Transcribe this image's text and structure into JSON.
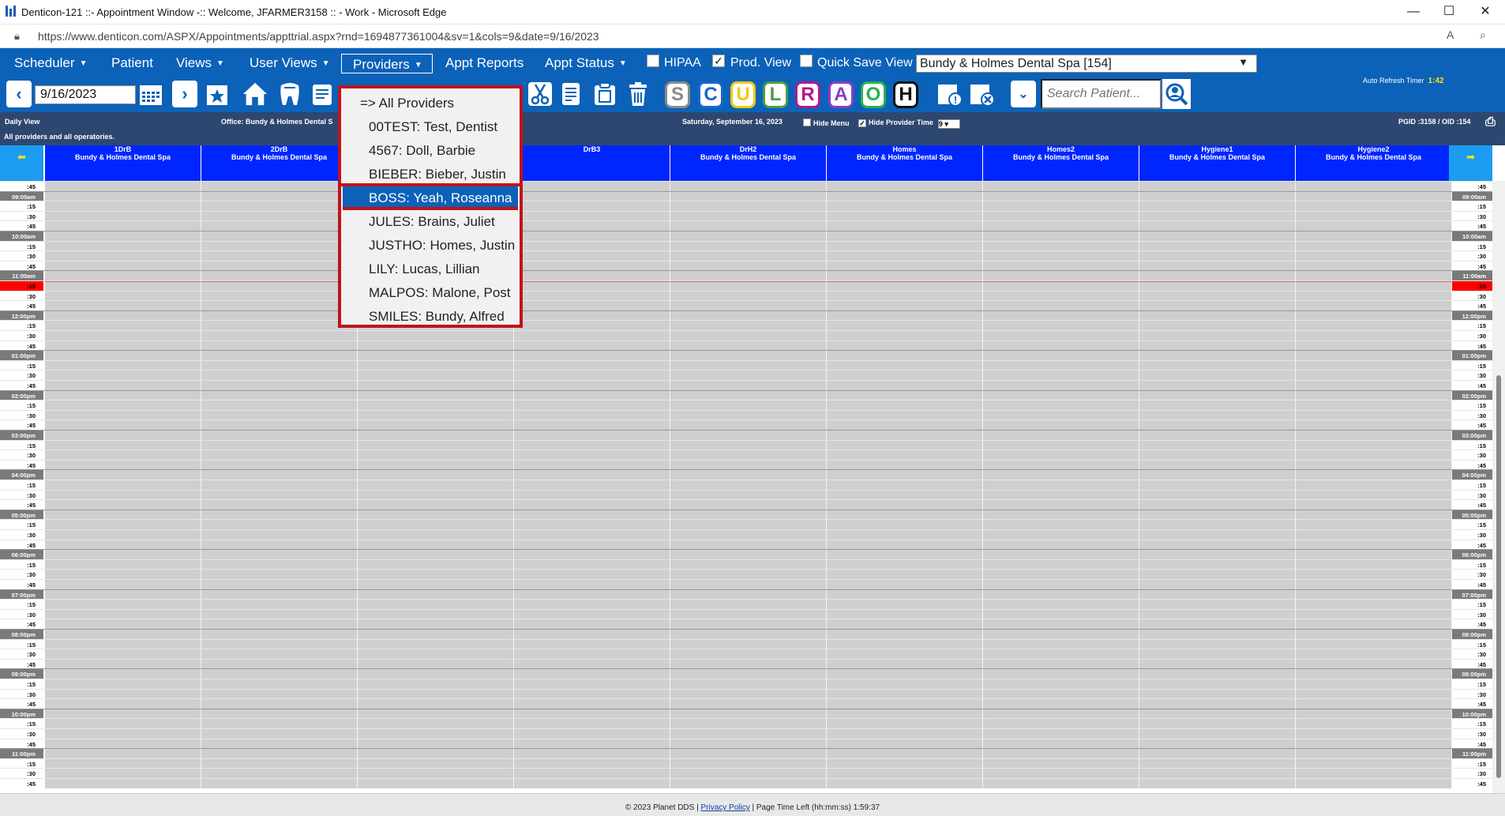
{
  "window": {
    "title": "Denticon-121 ::- Appointment Window -:: Welcome, JFARMER3158 :: - Work - Microsoft Edge"
  },
  "address": {
    "url": "https://www.denticon.com/ASPX/Appointments/appttrial.aspx?rnd=1694877361004&sv=1&cols=9&date=9/16/2023"
  },
  "menu": {
    "scheduler": "Scheduler",
    "patient": "Patient",
    "views": "Views",
    "user_views": "User Views",
    "providers": "Providers",
    "appt_reports": "Appt Reports",
    "appt_status": "Appt Status",
    "hipaa": "HIPAA",
    "prod_view": "Prod. View",
    "quick_save": "Quick Save View",
    "office": "Bundy & Holmes Dental Spa [154]"
  },
  "toolbar": {
    "date": "9/16/2023",
    "search_placeholder": "Search Patient...",
    "auto_refresh_label": "Auto Refresh Timer",
    "auto_refresh_value": "1:42",
    "letters": [
      {
        "t": "S",
        "color": "#8a8a8a"
      },
      {
        "t": "C",
        "color": "#1a66c9"
      },
      {
        "t": "U",
        "color": "#f2c80f"
      },
      {
        "t": "L",
        "color": "#4a9d47"
      },
      {
        "t": "R",
        "color": "#b5178c"
      },
      {
        "t": "A",
        "color": "#8a3cc9"
      },
      {
        "t": "O",
        "color": "#27b34a"
      },
      {
        "t": "H",
        "color": "#111111"
      }
    ]
  },
  "info": {
    "daily_view": "Daily View",
    "office": "Office: Bundy & Holmes Dental S",
    "all_providers": "All providers and all operatories.",
    "date": "Saturday, September 16, 2023",
    "hide_menu": "Hide Menu",
    "hide_provider_time": "Hide Provider Time",
    "cols": "9",
    "pgid": "PGID :3158  /  OID :154"
  },
  "columns": [
    {
      "name": "1DrB",
      "sub": "Bundy & Holmes Dental Spa"
    },
    {
      "name": "2DrB",
      "sub": "Bundy & Holmes Dental Spa"
    },
    {
      "name": "",
      "sub": ""
    },
    {
      "name": "DrB3",
      "sub": ""
    },
    {
      "name": "DrH2",
      "sub": "Bundy & Holmes Dental Spa"
    },
    {
      "name": "Homes",
      "sub": "Bundy & Holmes Dental Spa"
    },
    {
      "name": "Homes2",
      "sub": "Bundy & Holmes Dental Spa"
    },
    {
      "name": "Hygiene1",
      "sub": "Bundy & Holmes Dental Spa"
    },
    {
      "name": "Hygiene2",
      "sub": "Bundy & Holmes Dental Spa"
    }
  ],
  "times": [
    ":45",
    "09:00am",
    ":15",
    ":30",
    ":45",
    "10:00am",
    ":15",
    ":30",
    ":45",
    "11:00am",
    ":15",
    ":30",
    ":45",
    "12:00pm",
    ":15",
    ":30",
    ":45",
    "01:00pm",
    ":15",
    ":30",
    ":45",
    "02:00pm",
    ":15",
    ":30",
    ":45",
    "03:00pm",
    ":15",
    ":30",
    ":45",
    "04:00pm",
    ":15",
    ":30",
    ":45",
    "05:00pm",
    ":15",
    ":30",
    ":45",
    "06:00pm",
    ":15",
    ":30",
    ":45",
    "07:00pm",
    ":15",
    ":30",
    ":45",
    "08:00pm",
    ":15",
    ":30",
    ":45",
    "09:00pm",
    ":15",
    ":30",
    ":45",
    "10:00pm",
    ":15",
    ":30",
    ":45",
    "11:00pm",
    ":15",
    ":30",
    ":45"
  ],
  "current_time_index": 10,
  "providers_dropdown": [
    {
      "label": "=> All Providers",
      "first": true
    },
    {
      "label": "00TEST: Test, Dentist"
    },
    {
      "label": "4567: Doll, Barbie"
    },
    {
      "label": "BIEBER: Bieber, Justin",
      "sep": true
    },
    {
      "label": "BOSS: Yeah, Roseanna",
      "selected": true,
      "sep": true
    },
    {
      "label": "JULES: Brains, Juliet"
    },
    {
      "label": "JUSTHO: Homes, Justin"
    },
    {
      "label": "LILY: Lucas, Lillian"
    },
    {
      "label": "MALPOS: Malone, Post"
    },
    {
      "label": "SMILES: Bundy, Alfred"
    }
  ],
  "footer": {
    "copyright": "© 2023 Planet DDS |",
    "privacy": "Privacy Policy",
    "time_left": "| Page Time Left (hh:mm:ss) 1:59:37"
  }
}
